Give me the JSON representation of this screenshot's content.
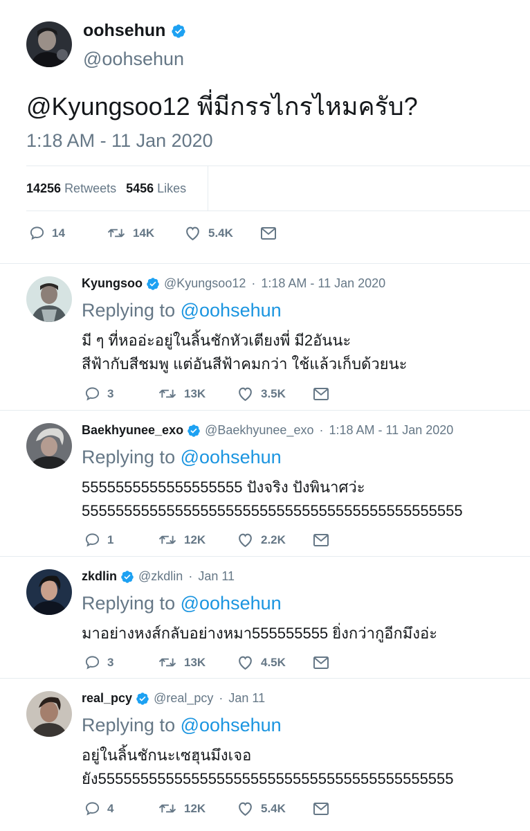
{
  "main_tweet": {
    "name": "oohsehun",
    "handle": "@oohsehun",
    "text": "@Kyungsoo12 พี่มีกรรไกรไหมครับ?",
    "timestamp": "1:18 AM - 11 Jan 2020",
    "stats": {
      "retweets_count": "14256",
      "retweets_label": "Retweets",
      "likes_count": "5456",
      "likes_label": "Likes"
    },
    "actions": {
      "replies": "14",
      "retweets": "14K",
      "likes": "5.4K"
    }
  },
  "replies": [
    {
      "name": "Kyungsoo",
      "handle": "@Kyungsoo12",
      "time": "1:18 AM - 11 Jan 2020",
      "replying_prefix": "Replying to",
      "replying_to": "@oohsehun",
      "text_lines": [
        "มี ๆ ที่หออ่ะอยู่ในลิ้นชักหัวเตียงพี่ มี2อันนะ",
        "สีฟ้ากับสีชมพู แต่อันสีฟ้าคมกว่า ใช้แล้วเก็บด้วยนะ"
      ],
      "replies": "3",
      "retweets": "13K",
      "likes": "3.5K"
    },
    {
      "name": "Baekhyunee_exo",
      "handle": "@Baekhyunee_exo",
      "time": "1:18 AM - 11 Jan 2020",
      "replying_prefix": "Replying to",
      "replying_to": "@oohsehun",
      "text_lines": [
        "5555555555555555555 ปังจริง ปังพินาศว่ะ",
        "555555555555555555555555555555555555555555555"
      ],
      "replies": "1",
      "retweets": "12K",
      "likes": "2.2K"
    },
    {
      "name": "zkdlin",
      "handle": "@zkdlin",
      "time": "Jan 11",
      "replying_prefix": "Replying to",
      "replying_to": "@oohsehun",
      "text_lines": [
        "มาอย่างหงส์กลับอย่างหมา555555555 ยิ่งกว่ากูอีกมึงอ่ะ"
      ],
      "replies": "3",
      "retweets": "13K",
      "likes": "4.5K"
    },
    {
      "name": "real_pcy",
      "handle": "@real_pcy",
      "time": "Jan 11",
      "replying_prefix": "Replying to",
      "replying_to": "@oohsehun",
      "text_lines": [
        "อยู่ในลิ้นชักนะเซฮุนมึงเจอ",
        "ยัง555555555555555555555555555555555555555555"
      ],
      "replies": "4",
      "retweets": "12K",
      "likes": "5.4K"
    }
  ],
  "icons": {
    "reply": "reply-icon",
    "retweet": "retweet-icon",
    "like": "heart-icon",
    "dm": "envelope-icon",
    "verified": "verified-badge-icon"
  },
  "colors": {
    "verified_blue": "#1da1f2",
    "mention_blue": "#1b95e0",
    "secondary_text": "#657786",
    "divider": "#e6ecf0"
  }
}
